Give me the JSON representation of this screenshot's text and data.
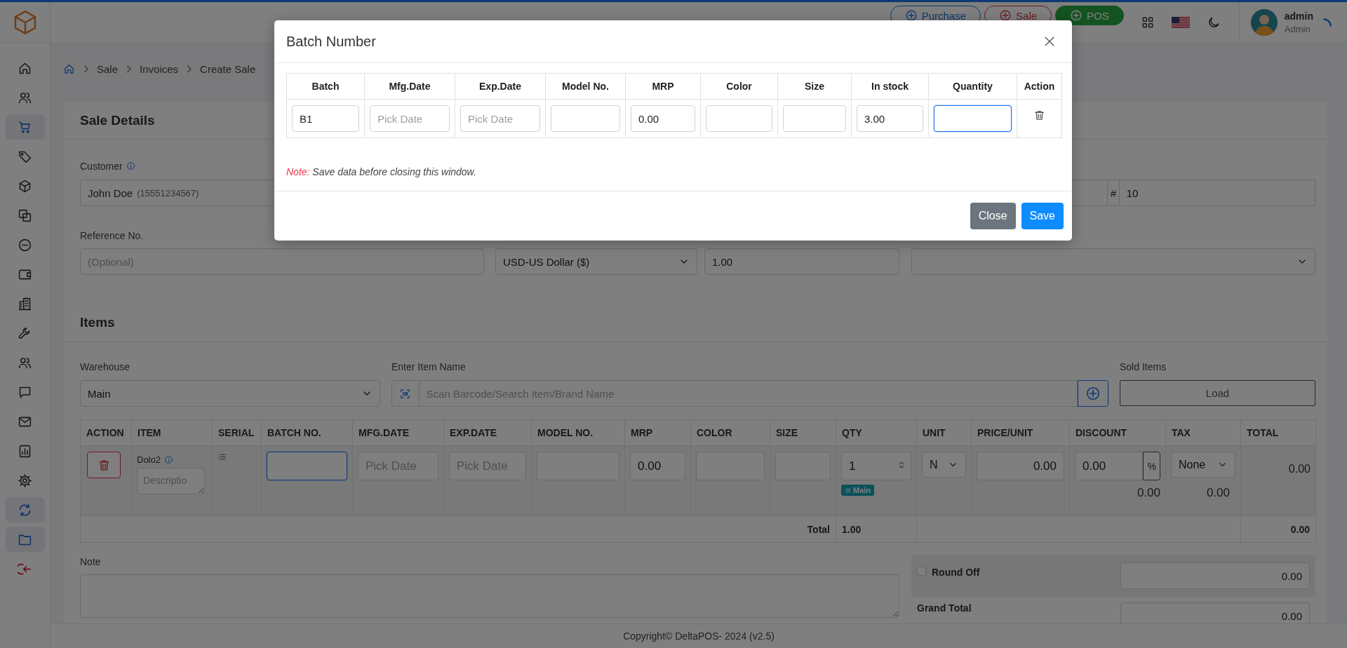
{
  "header": {
    "buttons": [
      {
        "label": "Purchase",
        "kind": "primary"
      },
      {
        "label": "Sale",
        "kind": "danger"
      },
      {
        "label": "POS",
        "kind": "success"
      }
    ],
    "user": {
      "name": "admin",
      "role": "Admin"
    }
  },
  "sidebar": {
    "items": [
      {
        "kind": "link",
        "highlighted": false
      },
      {
        "kind": "link",
        "highlighted": false
      },
      {
        "kind": "link",
        "highlighted": true
      },
      {
        "kind": "link",
        "highlighted": false
      },
      {
        "kind": "link",
        "highlighted": false
      },
      {
        "kind": "link",
        "highlighted": false
      },
      {
        "kind": "link",
        "highlighted": false
      },
      {
        "kind": "link",
        "highlighted": false
      },
      {
        "kind": "link",
        "highlighted": false
      },
      {
        "kind": "link",
        "highlighted": false
      },
      {
        "kind": "link",
        "highlighted": false
      },
      {
        "kind": "link",
        "highlighted": false
      },
      {
        "kind": "link",
        "highlighted": false
      },
      {
        "kind": "link",
        "highlighted": false
      },
      {
        "kind": "link",
        "highlighted": false
      },
      {
        "kind": "link",
        "highlighted": true
      },
      {
        "kind": "link",
        "highlighted": true
      },
      {
        "kind": "danger",
        "highlighted": false
      }
    ]
  },
  "breadcrumb": [
    "Sale",
    "Invoices",
    "Create Sale"
  ],
  "sale_details": {
    "title": "Sale Details",
    "customer": {
      "label": "Customer",
      "name": "John Doe",
      "phone": "(15551234567)"
    },
    "number": {
      "prefix": "#",
      "value": "10"
    },
    "reference": {
      "label": "Reference No.",
      "placeholder": "(Optional)"
    },
    "currency": {
      "value": "USD-US Dollar ($)"
    },
    "exchange_rate": {
      "value": "1.00"
    }
  },
  "items": {
    "title": "Items",
    "warehouse": {
      "label": "Warehouse",
      "value": "Main"
    },
    "search": {
      "label": "Enter Item Name",
      "placeholder": "Scan Barcode/Search Item/Brand Name"
    },
    "sold_items": {
      "label": "Sold Items",
      "button": "Load"
    },
    "table": {
      "columns": [
        "ACTION",
        "ITEM",
        "SERIAL",
        "BATCH NO.",
        "MFG.DATE",
        "EXP.DATE",
        "MODEL NO.",
        "MRP",
        "COLOR",
        "SIZE",
        "QTY",
        "UNIT",
        "PRICE/UNIT",
        "DISCOUNT",
        "TAX",
        "TOTAL"
      ],
      "rows": [
        {
          "cells": [
            {
              "kind": "delete"
            },
            {
              "kind": "item",
              "name": "Dolo2",
              "placeholder": "Descriptio"
            },
            {
              "kind": "serial"
            },
            {
              "kind": "input",
              "focused": true
            },
            {
              "kind": "input",
              "placeholder": "Pick Date",
              "focused": false
            },
            {
              "kind": "input",
              "placeholder": "Pick Date",
              "focused": false
            },
            {
              "kind": "input",
              "focused": false
            },
            {
              "kind": "input",
              "value": "0.00",
              "focused": false
            },
            {
              "kind": "input",
              "focused": false
            },
            {
              "kind": "input",
              "focused": false
            },
            {
              "kind": "qty",
              "value": "1",
              "badge": "Main"
            },
            {
              "kind": "select",
              "value": "N"
            },
            {
              "kind": "amount",
              "value": "0.00"
            },
            {
              "kind": "discount",
              "value": "0.00",
              "unit": "%",
              "amount": "0.00"
            },
            {
              "kind": "tax",
              "value": "None",
              "amount": "0.00"
            },
            {
              "kind": "text",
              "value": "0.00"
            }
          ]
        }
      ],
      "totals": {
        "label": "Total",
        "quantity": "1.00",
        "amount": "0.00"
      }
    }
  },
  "note": {
    "label": "Note"
  },
  "summary": {
    "round_off": {
      "label": "Round Off",
      "checked": false,
      "value": "0.00"
    },
    "grand_total": {
      "label": "Grand Total",
      "value": "0.00"
    }
  },
  "footer": "Copyright© DeltaPOS- 2024 (v2.5)",
  "modal": {
    "title": "Batch Number",
    "columns": [
      "Batch",
      "Mfg.Date",
      "Exp.Date",
      "Model No.",
      "MRP",
      "Color",
      "Size",
      "In stock",
      "Quantity",
      "Action"
    ],
    "rows": [
      {
        "cells": [
          {
            "kind": "input",
            "value": "B1",
            "focused": false
          },
          {
            "kind": "input",
            "placeholder": "Pick Date",
            "focused": false
          },
          {
            "kind": "input",
            "placeholder": "Pick Date",
            "focused": false
          },
          {
            "kind": "input",
            "focused": false
          },
          {
            "kind": "input",
            "value": "0.00",
            "focused": false
          },
          {
            "kind": "input",
            "focused": false
          },
          {
            "kind": "input",
            "focused": false
          },
          {
            "kind": "input",
            "value": "3.00",
            "focused": false
          },
          {
            "kind": "input",
            "focused": true
          },
          {
            "kind": "delete"
          }
        ]
      }
    ],
    "note_label": "Note:",
    "note_text": "Save data before closing this window.",
    "buttons": [
      {
        "label": "Close",
        "kind": "secondary"
      },
      {
        "label": "Save",
        "kind": "primary"
      }
    ]
  }
}
